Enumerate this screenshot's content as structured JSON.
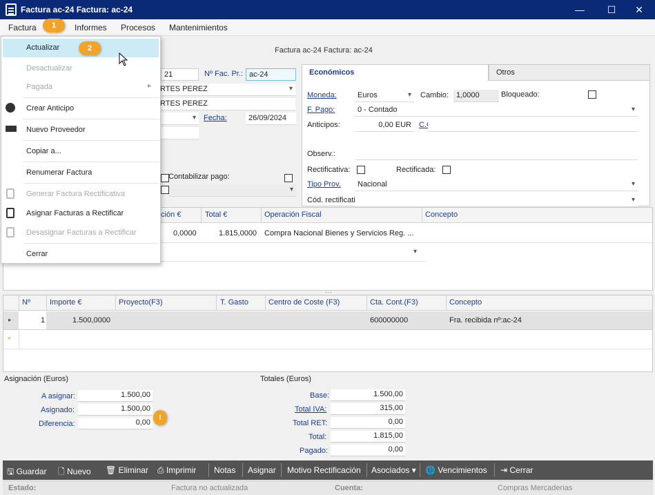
{
  "window": {
    "title": "Factura ac-24  Factura: ac-24",
    "minimize": "—",
    "maximize": "☐",
    "close": "✕"
  },
  "menubar": {
    "items": [
      "Factura",
      "Informes",
      "Procesos",
      "Mantenimientos"
    ]
  },
  "form_title": "Factura ac-24  Factura: ac-24",
  "header": {
    "num_partial": "21",
    "nfac_label": "Nº Fac. Pr.:",
    "nfac_value": "ac-24",
    "proveedor_a": "RTES PEREZ",
    "proveedor_b": "RTES PEREZ",
    "fecha_label": "Fecha:",
    "fecha_value": "26/09/2024",
    "contabilizar_label": "Contabilizar pago:"
  },
  "tabs": [
    "Económicos",
    "Otros"
  ],
  "economicos": {
    "moneda_label": "Moneda:",
    "moneda_value": "Euros",
    "cambio_label": "Cambio:",
    "cambio_value": "1,0000",
    "bloqueado_label": "Bloqueado:",
    "fpago_label": "F. Pago:",
    "fpago_value": "0 - Contado",
    "anticipos_label": "Anticipos:",
    "anticipos_value": "0,00 EUR",
    "cc_label": "C.C.:",
    "observ_label": "Observ.:",
    "rectificativa_label": "Rectificativa:",
    "rectificada_label": "Rectificada:",
    "tipoprov_label": "Tipo Prov.",
    "tipoprov_value": "Nacional",
    "codrect_label": "Cód. rectificativa"
  },
  "grid1": {
    "headers": [
      "nción €",
      "Total €",
      "Operación Fiscal",
      "Concepto"
    ],
    "row": {
      "retencion": "0,0000",
      "total": "1.815,0000",
      "operacion": "Compra Nacional Bienes y Servicios Reg. ..."
    }
  },
  "grid2": {
    "headers": [
      "Nº",
      "Importe €",
      "Proyecto(F3)",
      "T. Gasto",
      "Centro de Coste (F3)",
      "Cta. Cont.(F3)",
      "Concepto"
    ],
    "row": {
      "n": "1",
      "importe": "1.500,0000",
      "cta": "600000000",
      "concepto": "Fra. recibida nº:ac-24"
    },
    "new_row_marker": "*"
  },
  "asignacion": {
    "title": "Asignación (Euros)",
    "a_asignar_label": "A asignar:",
    "a_asignar_value": "1.500,00",
    "asignado_label": "Asignado:",
    "asignado_value": "1.500,00",
    "diferencia_label": "Diferencia:",
    "diferencia_value": "0,00"
  },
  "totales": {
    "title": "Totales (Euros)",
    "base_label": "Base:",
    "base_value": "1.500,00",
    "iva_label": "Total IVA:",
    "iva_value": "315,00",
    "ret_label": "Total RET:",
    "ret_value": "0,00",
    "total_label": "Total:",
    "total_value": "1.815,00",
    "pagado_label": "Pagado:",
    "pagado_value": "0,00"
  },
  "dropdown_menu": {
    "items": [
      {
        "label": "Actualizar"
      },
      {
        "label": "Desactualizar"
      },
      {
        "label": "Pagada"
      },
      {
        "label": "Crear Anticipo"
      },
      {
        "label": "Nuevo Proveedor"
      },
      {
        "label": "Copiar a..."
      },
      {
        "label": "Renumerar Factura"
      },
      {
        "label": "Generar Factura Rectificativa"
      },
      {
        "label": "Asignar Facturas a Rectificar"
      },
      {
        "label": "Desasignar Facturas a Rectificar"
      },
      {
        "label": "Cerrar"
      }
    ]
  },
  "bubbles": {
    "one": "1",
    "two": "2",
    "warn": "!"
  },
  "toolbar": {
    "guardar": "Guardar",
    "nuevo": "Nuevo",
    "eliminar": "Eliminar",
    "imprimir": "Imprimir",
    "notas": "Notas",
    "asignar": "Asignar",
    "motivo": "Motivo Rectificación",
    "asociados": "Asociados",
    "vencimientos": "Vencimientos",
    "cerrar": "Cerrar"
  },
  "statusbar": {
    "estado_label": "Estado:",
    "estado_value": "Factura no actualizada",
    "cuenta_label": "Cuenta:",
    "cuenta_value": "Compras Mercaderias"
  },
  "colors": {
    "titlebar": "#0a2a78",
    "accent_label": "#1b3b8a",
    "highlight": "#cdebf7",
    "bubble": "#f2a32a",
    "toolbar": "#535353"
  }
}
